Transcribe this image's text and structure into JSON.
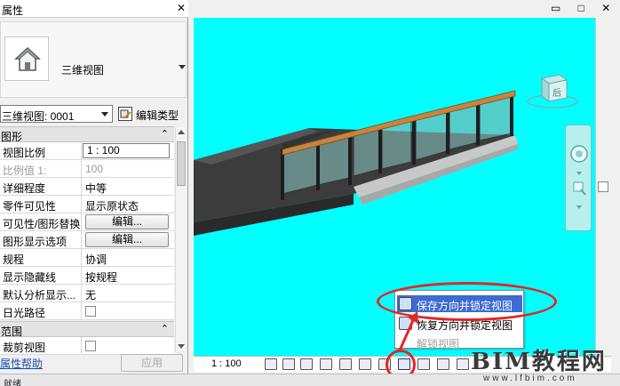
{
  "properties": {
    "title": "属性",
    "close_glyph": "✕",
    "type_name": "三维视图",
    "view_selector": "三维视图: 0001",
    "edit_type": "编辑类型",
    "help_link": "属性帮助",
    "apply_button": "应用",
    "sections": {
      "graphics": "图形",
      "extents": "范围"
    },
    "collapse_glyph": "⌃",
    "rows": {
      "view_scale": {
        "label": "视图比例",
        "value": "1 : 100"
      },
      "scale_value": {
        "label": "比例值 1:",
        "value": "100"
      },
      "detail_level": {
        "label": "详细程度",
        "value": "中等"
      },
      "parts_visibility": {
        "label": "零件可见性",
        "value": "显示原状态"
      },
      "vg_overrides": {
        "label": "可见性/图形替换",
        "value": "编辑..."
      },
      "graphic_display": {
        "label": "图形显示选项",
        "value": "编辑..."
      },
      "discipline": {
        "label": "规程",
        "value": "协调"
      },
      "hidden_lines": {
        "label": "显示隐藏线",
        "value": "按规程"
      },
      "default_analysis": {
        "label": "默认分析显示...",
        "value": "无"
      },
      "sun_path": {
        "label": "日光路径",
        "value": ""
      },
      "crop_view": {
        "label": "裁剪视图",
        "value": ""
      }
    }
  },
  "viewport": {
    "window_controls": "▭ □ ✕",
    "viewcube_face": "后",
    "background_color": "#00ffff"
  },
  "view_bar": {
    "scale": "1 : 100"
  },
  "popup_menu": {
    "items": [
      {
        "label": "保存方向并锁定视图",
        "state": "selected"
      },
      {
        "label": "恢复方向并锁定视图",
        "state": "enabled"
      },
      {
        "label": "解锁视图",
        "state": "disabled"
      }
    ]
  },
  "status_bar": {
    "text": "就绪"
  },
  "watermark": {
    "main": "BIM教程网",
    "url": "www.lfbim.com"
  },
  "colors": {
    "viewport_bg": "#00ffff",
    "menu_highlight": "#3c6bd1",
    "callout": "#e52525",
    "link": "#1a4fb0"
  }
}
